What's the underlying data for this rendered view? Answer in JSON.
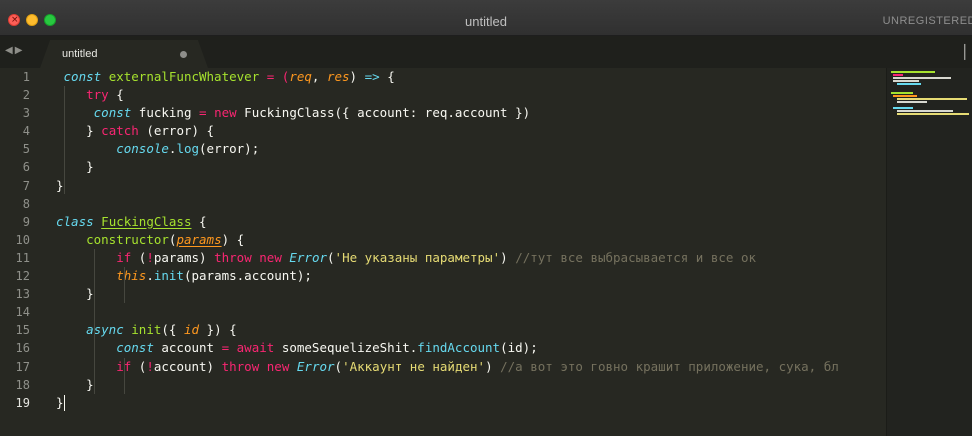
{
  "window": {
    "title": "untitled",
    "unregistered": "UNREGISTERED",
    "close_glyph": "×"
  },
  "tabs": [
    {
      "label": "untitled",
      "modified": true
    }
  ],
  "nav": {
    "back": "◀",
    "forward": "▶",
    "more": "❘"
  },
  "editor": {
    "line_numbers": [
      "1",
      "2",
      "3",
      "4",
      "5",
      "6",
      "7",
      "8",
      "9",
      "10",
      "11",
      "12",
      "13",
      "14",
      "15",
      "16",
      "17",
      "18",
      "19"
    ],
    "current_line": 19,
    "code": {
      "l1": [
        "const",
        " ",
        "externalFuncWhatever",
        " = (",
        "req",
        ", ",
        "res",
        ") ",
        "=>",
        " {"
      ],
      "l2": [
        "try",
        " {"
      ],
      "l3": [
        "const",
        " fucking ",
        "=",
        " ",
        "new",
        " FuckingClass({ account: req.account })"
      ],
      "l4": [
        "} ",
        "catch",
        " (error) {"
      ],
      "l5": [
        "console",
        ".",
        "log",
        "(error);"
      ],
      "l6": [
        "}"
      ],
      "l7": [
        "}"
      ],
      "l9": [
        "class",
        " ",
        "FuckingClass",
        " {"
      ],
      "l10": [
        "constructor",
        "(",
        "params",
        ") {"
      ],
      "l11": [
        "if",
        " (",
        "!",
        "params) ",
        "throw",
        " ",
        "new",
        " ",
        "Error",
        "(",
        "'Не указаны параметры'",
        ") ",
        "//тут все выбрасывается и все ок"
      ],
      "l12": [
        "this",
        ".",
        "init",
        "(params.account);"
      ],
      "l13": [
        "}"
      ],
      "l15": [
        "async",
        " ",
        "init",
        "({ ",
        "id",
        " }) {"
      ],
      "l16": [
        "const",
        " account ",
        "=",
        " ",
        "await",
        " someSequelizeShit.",
        "findAccount",
        "(id);"
      ],
      "l17": [
        "if",
        " (",
        "!",
        "account) ",
        "throw",
        " ",
        "new",
        " ",
        "Error",
        "(",
        "'Аккаунт не найден'",
        ") ",
        "//а вот это говно крашит приложение, сука, бл"
      ],
      "l18": [
        "}"
      ],
      "l19": [
        "}"
      ]
    }
  },
  "colors": {
    "background": "#272822",
    "keyword": "#f92672",
    "storage": "#66d9ef",
    "function": "#a6e22e",
    "parameter": "#fd971f",
    "string": "#e6db74",
    "comment": "#75715e",
    "text": "#f8f8f2"
  }
}
